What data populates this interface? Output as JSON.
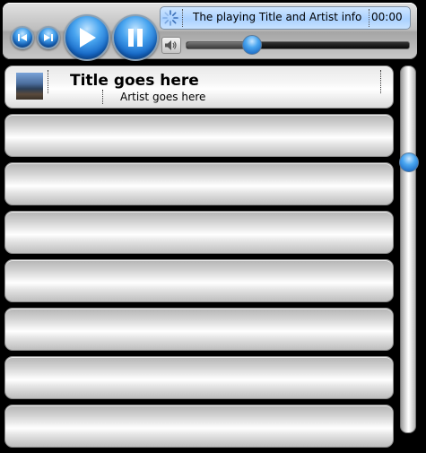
{
  "player": {
    "now_playing": "The playing Title and Artist info",
    "time": "00:00",
    "seek_progress": 0.29
  },
  "icons": {
    "prev": "previous-track-icon",
    "next": "next-track-icon",
    "play": "play-icon",
    "pause": "pause-icon",
    "volume": "speaker-icon",
    "spinner": "loading-spinner-icon"
  },
  "playlist": {
    "items": [
      {
        "title": "Title goes here",
        "artist": "Artist goes here"
      },
      {
        "title": "",
        "artist": ""
      },
      {
        "title": "",
        "artist": ""
      },
      {
        "title": "",
        "artist": ""
      },
      {
        "title": "",
        "artist": ""
      },
      {
        "title": "",
        "artist": ""
      },
      {
        "title": "",
        "artist": ""
      },
      {
        "title": "",
        "artist": ""
      }
    ]
  },
  "scrollbar": {
    "position": 0.25
  },
  "colors": {
    "accent": "#1668c7",
    "info_panel": "#aad1ff"
  }
}
